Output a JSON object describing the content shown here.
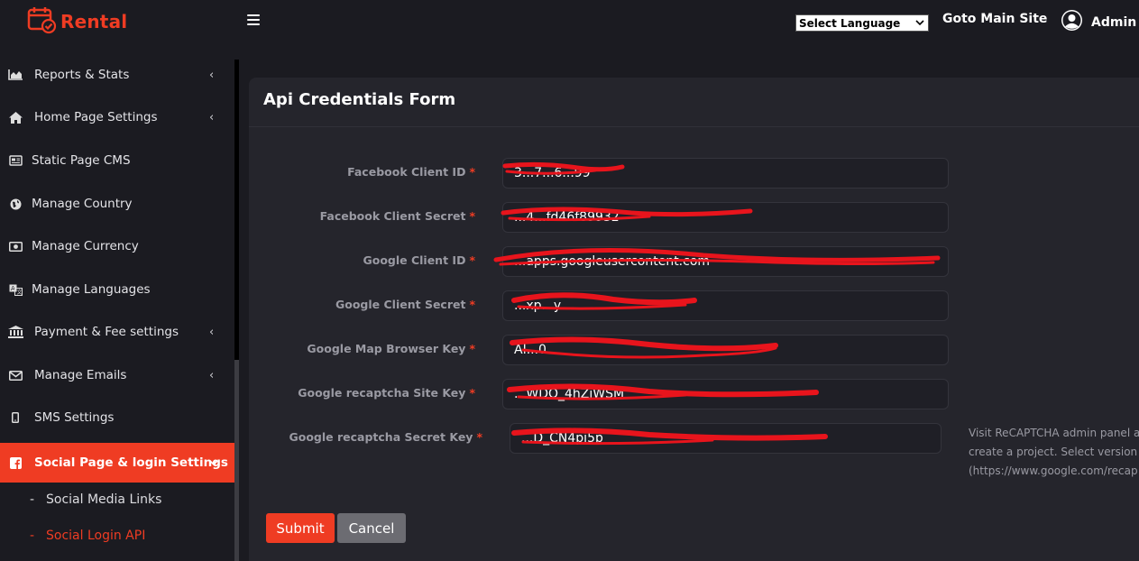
{
  "brand": {
    "name": "Rental",
    "accent": "#ef3c23"
  },
  "header": {
    "language_select": "Select Language",
    "goto_main": "Goto Main Site",
    "user": "Admin"
  },
  "sidebar": {
    "items": [
      {
        "label": "Reports & Stats",
        "icon": "chart-area-icon",
        "has_chevron": true
      },
      {
        "label": "Home Page Settings",
        "icon": "home-icon",
        "has_chevron": true
      },
      {
        "label": "Static Page CMS",
        "icon": "newspaper-icon",
        "has_chevron": false
      },
      {
        "label": "Manage Country",
        "icon": "globe-icon",
        "has_chevron": false
      },
      {
        "label": "Manage Currency",
        "icon": "money-icon",
        "has_chevron": false
      },
      {
        "label": "Manage Languages",
        "icon": "language-icon",
        "has_chevron": false
      },
      {
        "label": "Payment & Fee settings",
        "icon": "bank-icon",
        "has_chevron": true
      },
      {
        "label": "Manage Emails",
        "icon": "envelope-icon",
        "has_chevron": true
      },
      {
        "label": "SMS Settings",
        "icon": "mobile-icon",
        "has_chevron": false
      },
      {
        "label": "Social Page & login Settings",
        "icon": "facebook-icon",
        "has_chevron": true,
        "active": true
      }
    ],
    "subitems": [
      {
        "label": "Social Media Links",
        "current": false
      },
      {
        "label": "Social Login API",
        "current": true
      }
    ]
  },
  "form": {
    "title": "Api Credentials Form",
    "fields": [
      {
        "label": "Facebook Client ID",
        "value": "3...7...6...99"
      },
      {
        "label": "Facebook Client Secret",
        "value": "...4...fd46f89932"
      },
      {
        "label": "Google Client ID",
        "value": "...apps.googleusercontent.com"
      },
      {
        "label": "Google Client Secret",
        "value": "...xp...y"
      },
      {
        "label": "Google Map Browser Key",
        "value": "AI...0"
      },
      {
        "label": "Google recaptcha Site Key",
        "value": "...WDO_4hZiWSM"
      },
      {
        "label": "Google recaptcha Secret Key",
        "value": "...D_CN4pi5p"
      }
    ],
    "help_text": [
      "Visit ReCAPTCHA admin panel a",
      "create a project. Select version v",
      "(https://www.google.com/recap"
    ],
    "submit": "Submit",
    "cancel": "Cancel"
  },
  "colors": {
    "bg": "#1b1b21",
    "card": "#25252c",
    "redaction": "#e8141c"
  }
}
